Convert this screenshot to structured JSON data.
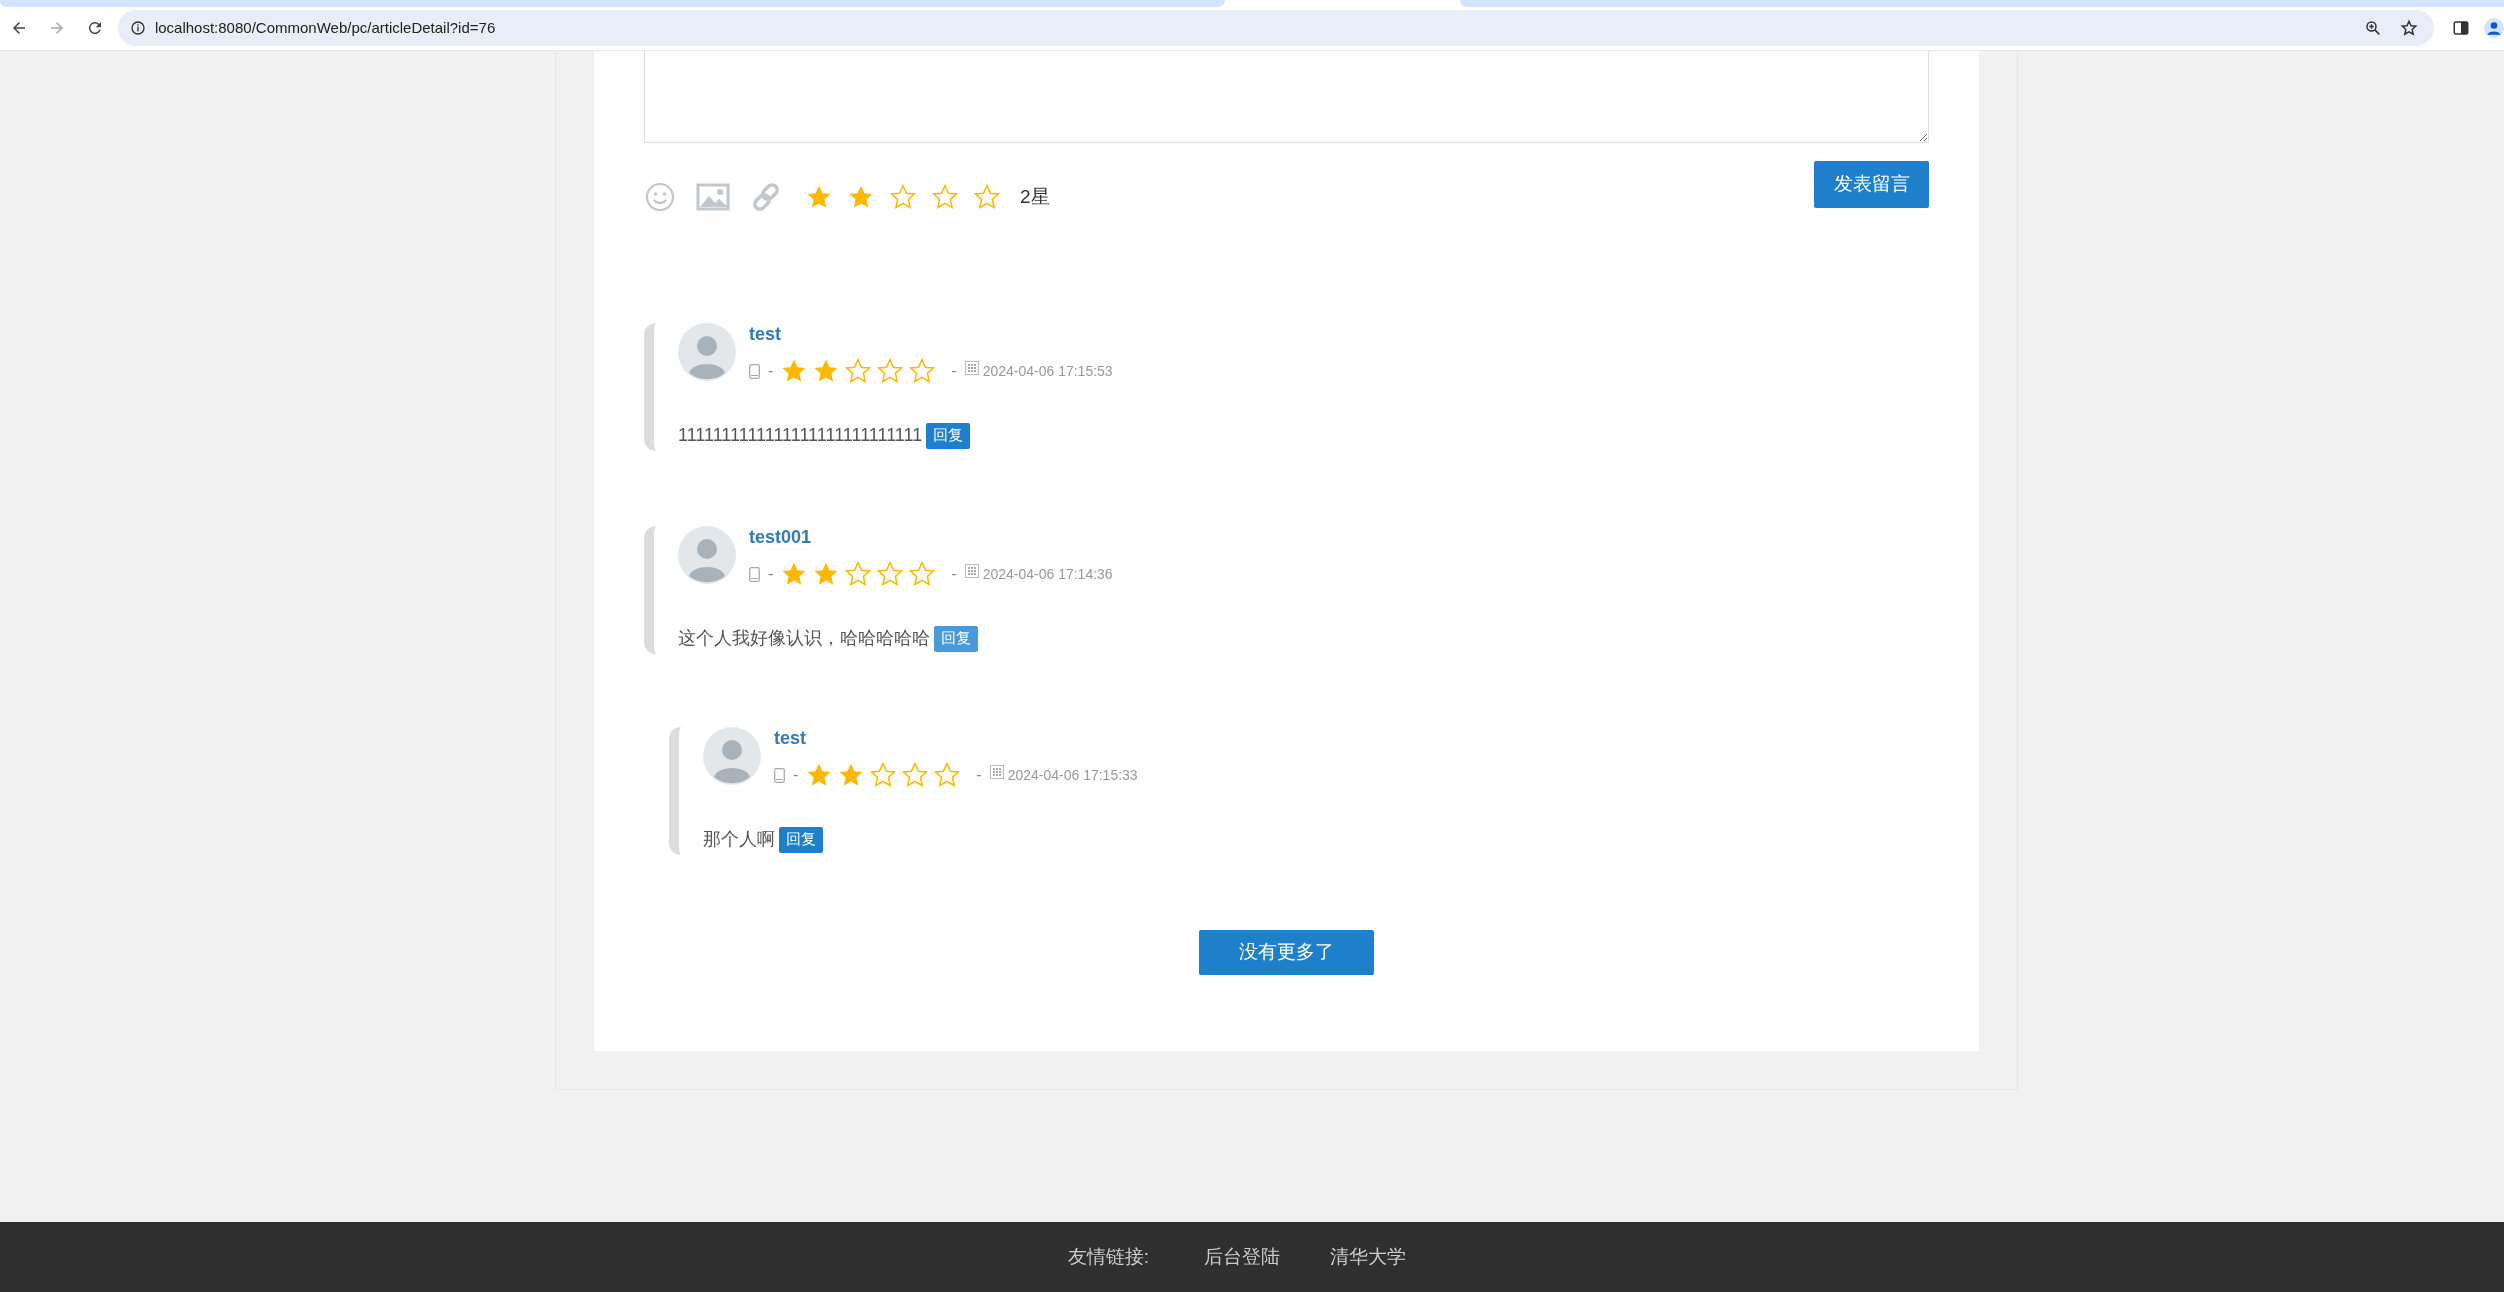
{
  "browser": {
    "url": "localhost:8080/CommonWeb/pc/articleDetail?id=76"
  },
  "comment_form": {
    "stars": 2,
    "rating_label": "2星",
    "submit": "发表留言"
  },
  "comments": [
    {
      "user": "test",
      "separators": [
        "-",
        "-"
      ],
      "stars": 2,
      "time": "2024-04-06 17:15:53",
      "text": "1111111111111111111111111111",
      "reply": "回复",
      "hovered": false
    },
    {
      "user": "test001",
      "separators": [
        "-",
        "-"
      ],
      "stars": 2,
      "time": "2024-04-06 17:14:36",
      "text": "这个人我好像认识，哈哈哈哈哈",
      "reply": "回复",
      "hovered": true,
      "children": [
        {
          "user": "test",
          "separators": [
            "-",
            "-"
          ],
          "stars": 2,
          "time": "2024-04-06 17:15:33",
          "text": "那个人啊",
          "reply": "回复",
          "hovered": false
        }
      ]
    }
  ],
  "load_more": "没有更多了",
  "footer": {
    "label": "友情链接:",
    "links": [
      "后台登陆",
      "清华大学"
    ]
  }
}
